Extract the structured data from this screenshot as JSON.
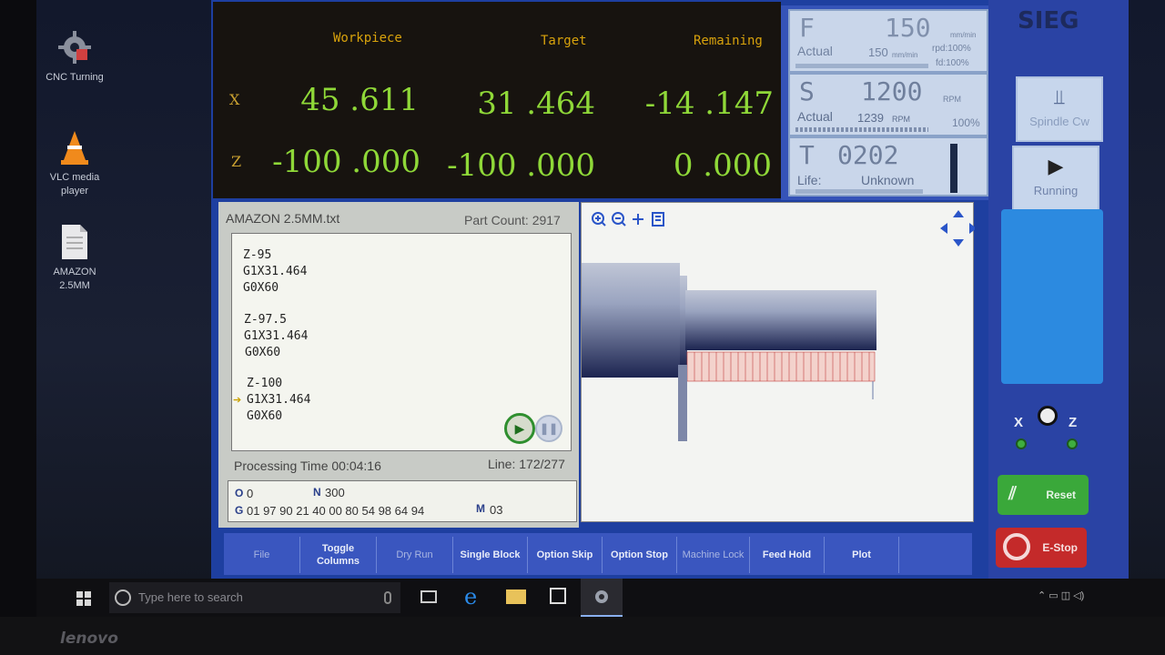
{
  "desktop": {
    "icons": [
      {
        "label": "CNC Turning",
        "icon": "gear-icon"
      },
      {
        "label": "VLC media player",
        "icon": "traffic-cone-icon"
      },
      {
        "label": "AMAZON 2.5MM",
        "icon": "document-icon"
      }
    ]
  },
  "dro": {
    "headers": {
      "workpiece": "Workpiece",
      "target": "Target",
      "remaining": "Remaining"
    },
    "x": {
      "axis": "X",
      "workpiece": "45 .611",
      "target": "31 .464",
      "remaining": "-14 .147"
    },
    "z": {
      "axis": "Z",
      "workpiece": "-100 .000",
      "target": "-100 .000",
      "remaining": "0 .000"
    }
  },
  "feed": {
    "letter": "F",
    "value": "150",
    "actual_label": "Actual",
    "actual": "150",
    "actual_unit": "mm/min",
    "rpd": "rpd:100%",
    "fd": "fd:100%",
    "unit": "mm/min"
  },
  "spindle": {
    "letter": "S",
    "value": "1200",
    "unit": "RPM",
    "actual_label": "Actual",
    "actual": "1239",
    "actual_unit": "RPM",
    "override": "100%"
  },
  "tool": {
    "letter": "T",
    "value": "0202",
    "life_label": "Life:",
    "life": "Unknown"
  },
  "right_panel": {
    "spindle_btn": "Spindle Cw",
    "running_btn": "Running",
    "x_label": "X",
    "z_label": "Z",
    "reset_btn": "Reset",
    "estop_btn": "E-Stop"
  },
  "program": {
    "filename": "AMAZON 2.5MM.txt",
    "part_count": "Part Count: 2917",
    "lines": [
      "Z-95",
      "G1X31.464",
      "G0X60",
      "Z-97.5",
      "G1X31.464",
      "G0X60",
      "Z-100",
      "G1X31.464",
      "G0X60"
    ],
    "current_line_index": 7,
    "processing_time": "Processing Time 00:04:16",
    "line_counter": "Line: 172/277",
    "o_value": "0",
    "n_value": "300",
    "g_codes": "01 97 90 21 40 00 80 54 98 64 94",
    "m_value": "03",
    "o_label": "O",
    "n_label": "N",
    "g_label": "G",
    "m_label": "M"
  },
  "toolbar": {
    "buttons": [
      {
        "label": "File",
        "enabled": false
      },
      {
        "label": "Toggle Columns",
        "enabled": true
      },
      {
        "label": "Dry Run",
        "enabled": false
      },
      {
        "label": "Single Block",
        "enabled": true
      },
      {
        "label": "Option Skip",
        "enabled": true
      },
      {
        "label": "Option Stop",
        "enabled": true
      },
      {
        "label": "Machine Lock",
        "enabled": false
      },
      {
        "label": "Feed Hold",
        "enabled": true
      },
      {
        "label": "Plot",
        "enabled": true
      }
    ]
  },
  "taskbar": {
    "search_placeholder": "Type here to search"
  },
  "brand": {
    "laptop": "lenovo",
    "app": "SIEG"
  },
  "colors": {
    "dro_header": "#d8a20c",
    "dro_value": "#8fd838",
    "app_blue": "#1e3fa0",
    "reset_green": "#3aa83a",
    "estop_red": "#c42a2a"
  }
}
